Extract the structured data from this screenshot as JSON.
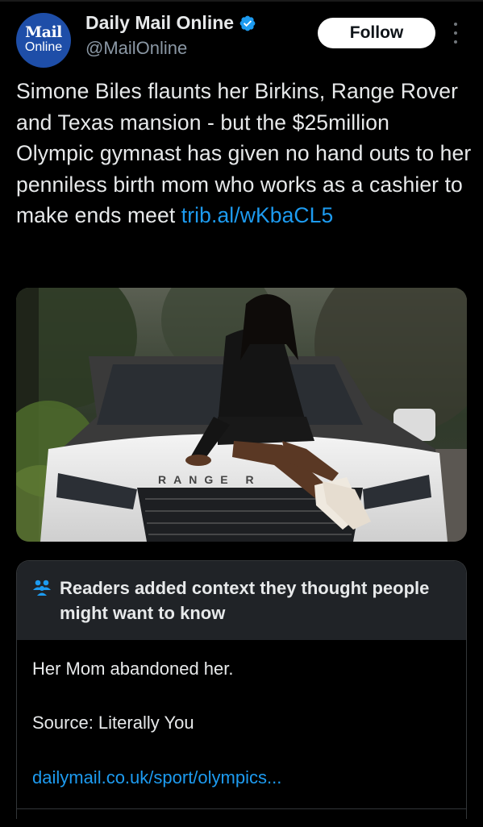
{
  "author": {
    "avatar_line1": "Mail",
    "avatar_line2": "Online",
    "display_name": "Daily Mail Online",
    "handle": "@MailOnline",
    "verified": true
  },
  "actions": {
    "follow_label": "Follow"
  },
  "tweet": {
    "text": "Simone Biles flaunts her Birkins, Range Rover and Texas mansion - but the $25million Olympic gymnast has given no hand outs to her penniless birth mom who works as a cashier to make ends meet",
    "link": "trib.al/wKbaCL5"
  },
  "media": {
    "badge_text": "RANGE R"
  },
  "community_note": {
    "title": "Readers added context they thought people might want to know",
    "body": "Her Mom abandoned her.",
    "source": "Source: Literally You",
    "link": "dailymail.co.uk/sport/olympics..."
  },
  "colors": {
    "background": "#000000",
    "text": "#e7e9ea",
    "muted": "#8b98a5",
    "link": "#1d9bf0",
    "verified": "#1d9bf0",
    "avatar": "#1e4ea8",
    "note_header": "#202327"
  },
  "icons": [
    "verified-badge-icon",
    "more-options-icon",
    "people-icon"
  ]
}
